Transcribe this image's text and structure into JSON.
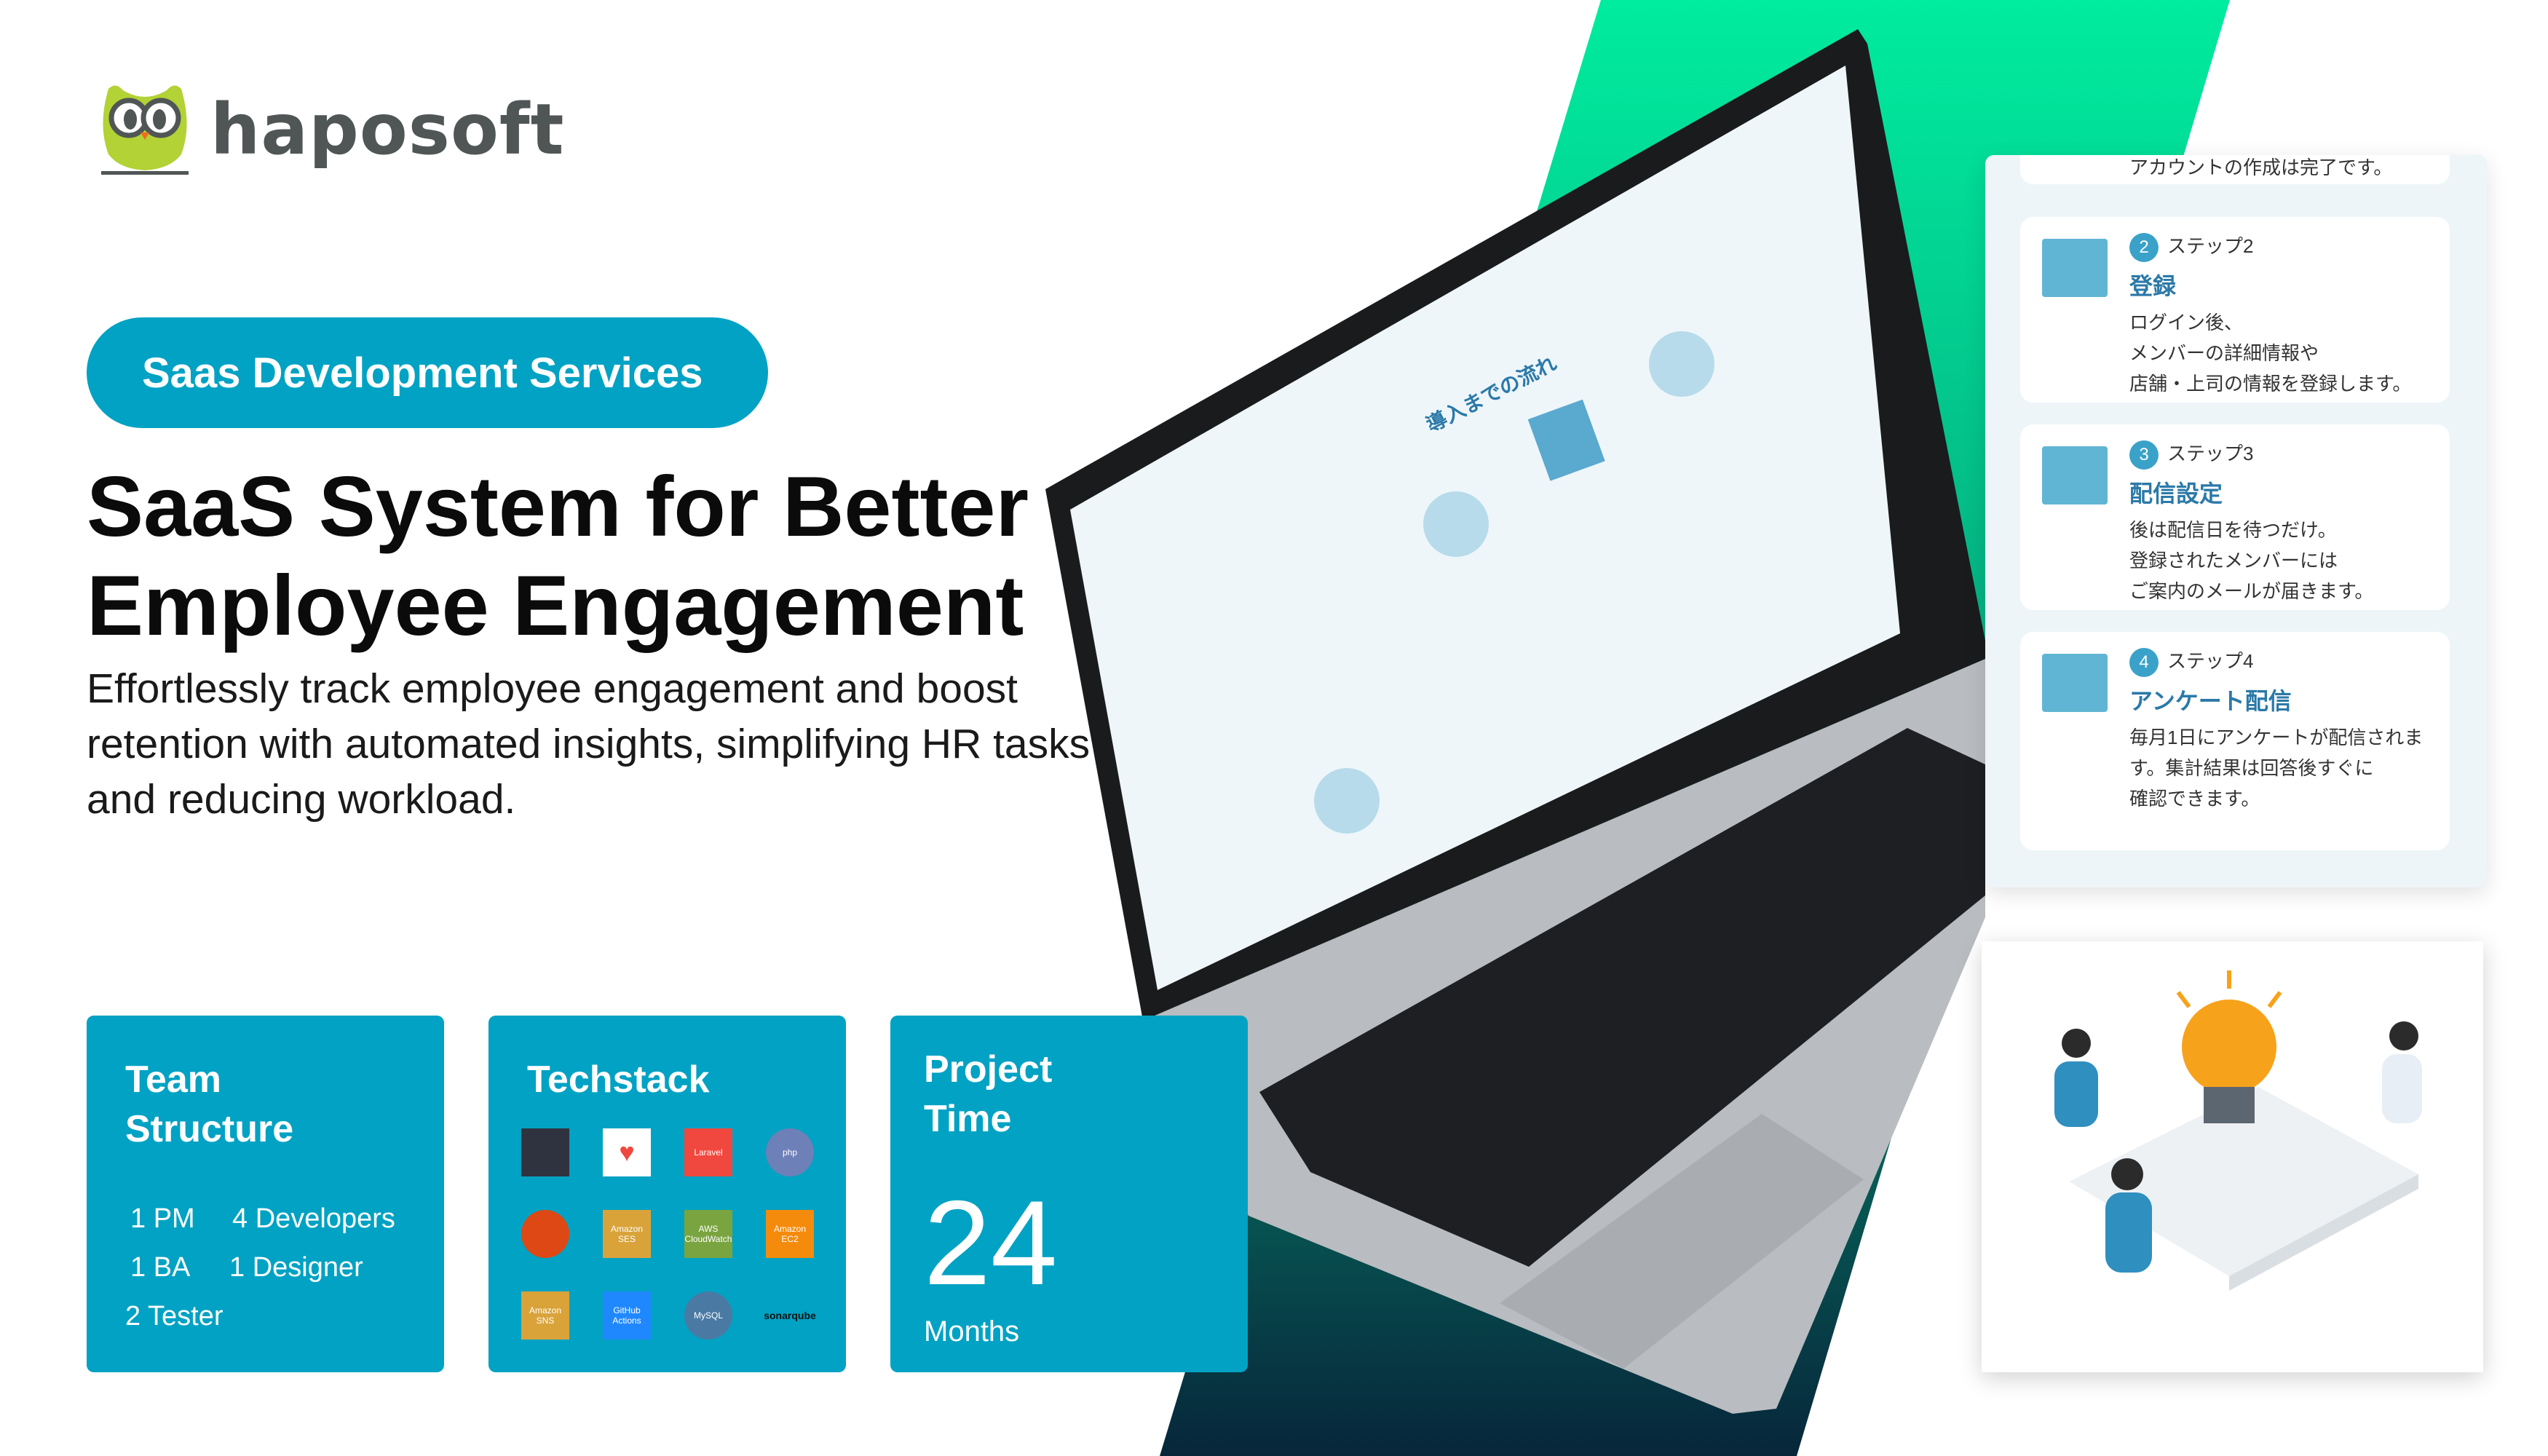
{
  "brand": {
    "name": "haposoft",
    "accent": "#01a2c3",
    "logo_green": "#b2d235"
  },
  "hero": {
    "badge": "Saas Development Services",
    "title_line1": "SaaS System for Better",
    "title_line2": "Employee Engagement",
    "description": "Effortlessly track employee engagement and boost retention with automated insights, simplifying HR tasks and reducing workload."
  },
  "cards": {
    "team": {
      "title_line1": "Team",
      "title_line2": "Structure",
      "rows": [
        [
          "1 PM",
          "4 Developers"
        ],
        [
          "1 BA",
          "1 Designer"
        ],
        [
          "2 Tester",
          ""
        ]
      ]
    },
    "techstack": {
      "title": "Techstack",
      "icons": [
        {
          "name": "dark-logo-icon",
          "label": "",
          "color": "#2f3340"
        },
        {
          "name": "heart-logo-icon",
          "label": "",
          "color": "#ffffff"
        },
        {
          "name": "laravel-icon",
          "label": "Laravel",
          "color": "#f0483e"
        },
        {
          "name": "php-icon",
          "label": "php",
          "color": "#6e80b8"
        },
        {
          "name": "ubuntu-icon",
          "label": "",
          "color": "#dd4814"
        },
        {
          "name": "amazon-ses-icon",
          "label": "Amazon SES",
          "color": "#d9a33a"
        },
        {
          "name": "aws-cloudwatch-icon",
          "label": "AWS CloudWatch",
          "color": "#7aa43f"
        },
        {
          "name": "amazon-ec2-icon",
          "label": "Amazon EC2",
          "color": "#f58b0c"
        },
        {
          "name": "amazon-sns-icon",
          "label": "Amazon SNS",
          "color": "#d9a33a"
        },
        {
          "name": "github-actions-icon",
          "label": "GitHub Actions",
          "color": "#2088ff"
        },
        {
          "name": "mysql-icon",
          "label": "MySQL",
          "color": "#4a7aa4"
        },
        {
          "name": "sonarqube-icon",
          "label": "sonarqube",
          "color": "#01a2c3"
        }
      ]
    },
    "project_time": {
      "title_line1": "Project",
      "title_line2": "Time",
      "value": "24",
      "unit": "Months"
    }
  },
  "laptop": {
    "screen_heading": "導入までの流れ"
  },
  "steps_panel": {
    "partial": "アカウントの作成は完了です。",
    "steps": [
      {
        "num": "2",
        "label": "ステップ2",
        "title": "登録",
        "text": "ログイン後、\nメンバーの詳細情報や\n店舗・上司の情報を登録します。"
      },
      {
        "num": "3",
        "label": "ステップ3",
        "title": "配信設定",
        "text": "後は配信日を待つだけ。\n登録されたメンバーには\nご案内のメールが届きます。"
      },
      {
        "num": "4",
        "label": "ステップ4",
        "title": "アンケート配信",
        "text": "毎月1日にアンケートが配信されま\nす。集計結果は回答後すぐに\n確認できます。"
      }
    ]
  }
}
